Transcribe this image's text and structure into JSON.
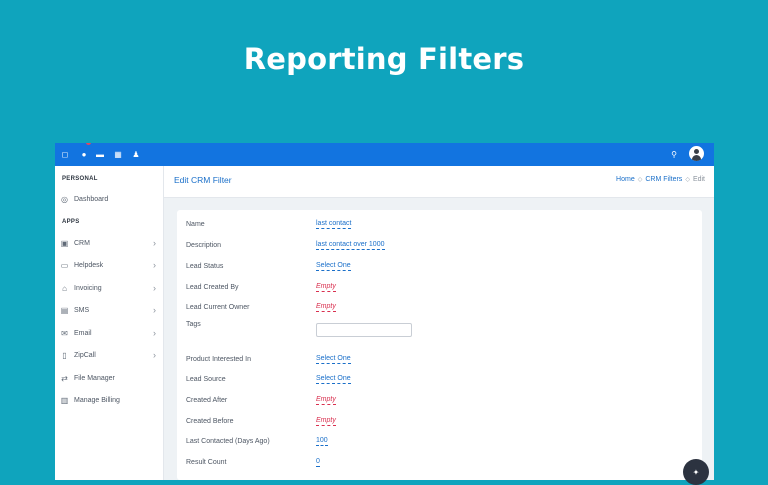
{
  "hero": {
    "title": "Reporting Filters"
  },
  "topbar": {
    "icons": [
      "home-icon",
      "notification-icon",
      "chat-icon",
      "apps-grid-icon",
      "user-icon",
      "search-icon"
    ]
  },
  "sidebar": {
    "sections": {
      "personal": "PERSONAL",
      "apps": "APPS"
    },
    "personal_items": [
      {
        "label": "Dashboard",
        "icon": "dashboard-icon"
      }
    ],
    "app_items": [
      {
        "label": "CRM",
        "icon": "crm-icon",
        "expandable": true
      },
      {
        "label": "Helpdesk",
        "icon": "monitor-icon",
        "expandable": true
      },
      {
        "label": "Invoicing",
        "icon": "bank-icon",
        "expandable": true
      },
      {
        "label": "SMS",
        "icon": "message-icon",
        "expandable": true
      },
      {
        "label": "Email",
        "icon": "mail-icon",
        "expandable": true
      },
      {
        "label": "ZipCall",
        "icon": "phone-icon",
        "expandable": true
      },
      {
        "label": "File Manager",
        "icon": "file-manager-icon",
        "expandable": false
      },
      {
        "label": "Manage Billing",
        "icon": "billing-icon",
        "expandable": false
      }
    ]
  },
  "header": {
    "title": "Edit CRM Filter",
    "breadcrumb": {
      "home": "Home",
      "crm_filters": "CRM Filters",
      "current": "Edit"
    }
  },
  "form": {
    "fields": [
      {
        "label": "Name",
        "value": "last contact",
        "kind": "link"
      },
      {
        "label": "Description",
        "value": "last contact over 1000",
        "kind": "link"
      },
      {
        "label": "Lead Status",
        "value": "Select One",
        "kind": "link"
      },
      {
        "label": "Lead Created By",
        "value": "Empty",
        "kind": "empty"
      },
      {
        "label": "Lead Current Owner",
        "value": "Empty",
        "kind": "empty"
      },
      {
        "label": "Tags",
        "value": "",
        "kind": "input"
      },
      {
        "label": "Product Interested In",
        "value": "Select One",
        "kind": "link"
      },
      {
        "label": "Lead Source",
        "value": "Select One",
        "kind": "link"
      },
      {
        "label": "Created After",
        "value": "Empty",
        "kind": "empty"
      },
      {
        "label": "Created Before",
        "value": "Empty",
        "kind": "empty"
      },
      {
        "label": "Last Contacted (Days Ago)",
        "value": "100",
        "kind": "link"
      },
      {
        "label": "Result Count",
        "value": "0",
        "kind": "link"
      }
    ]
  },
  "colors": {
    "background": "#0fa4bd",
    "topbar": "#1274e0",
    "link": "#1a6fc9",
    "empty": "#d9304f"
  }
}
